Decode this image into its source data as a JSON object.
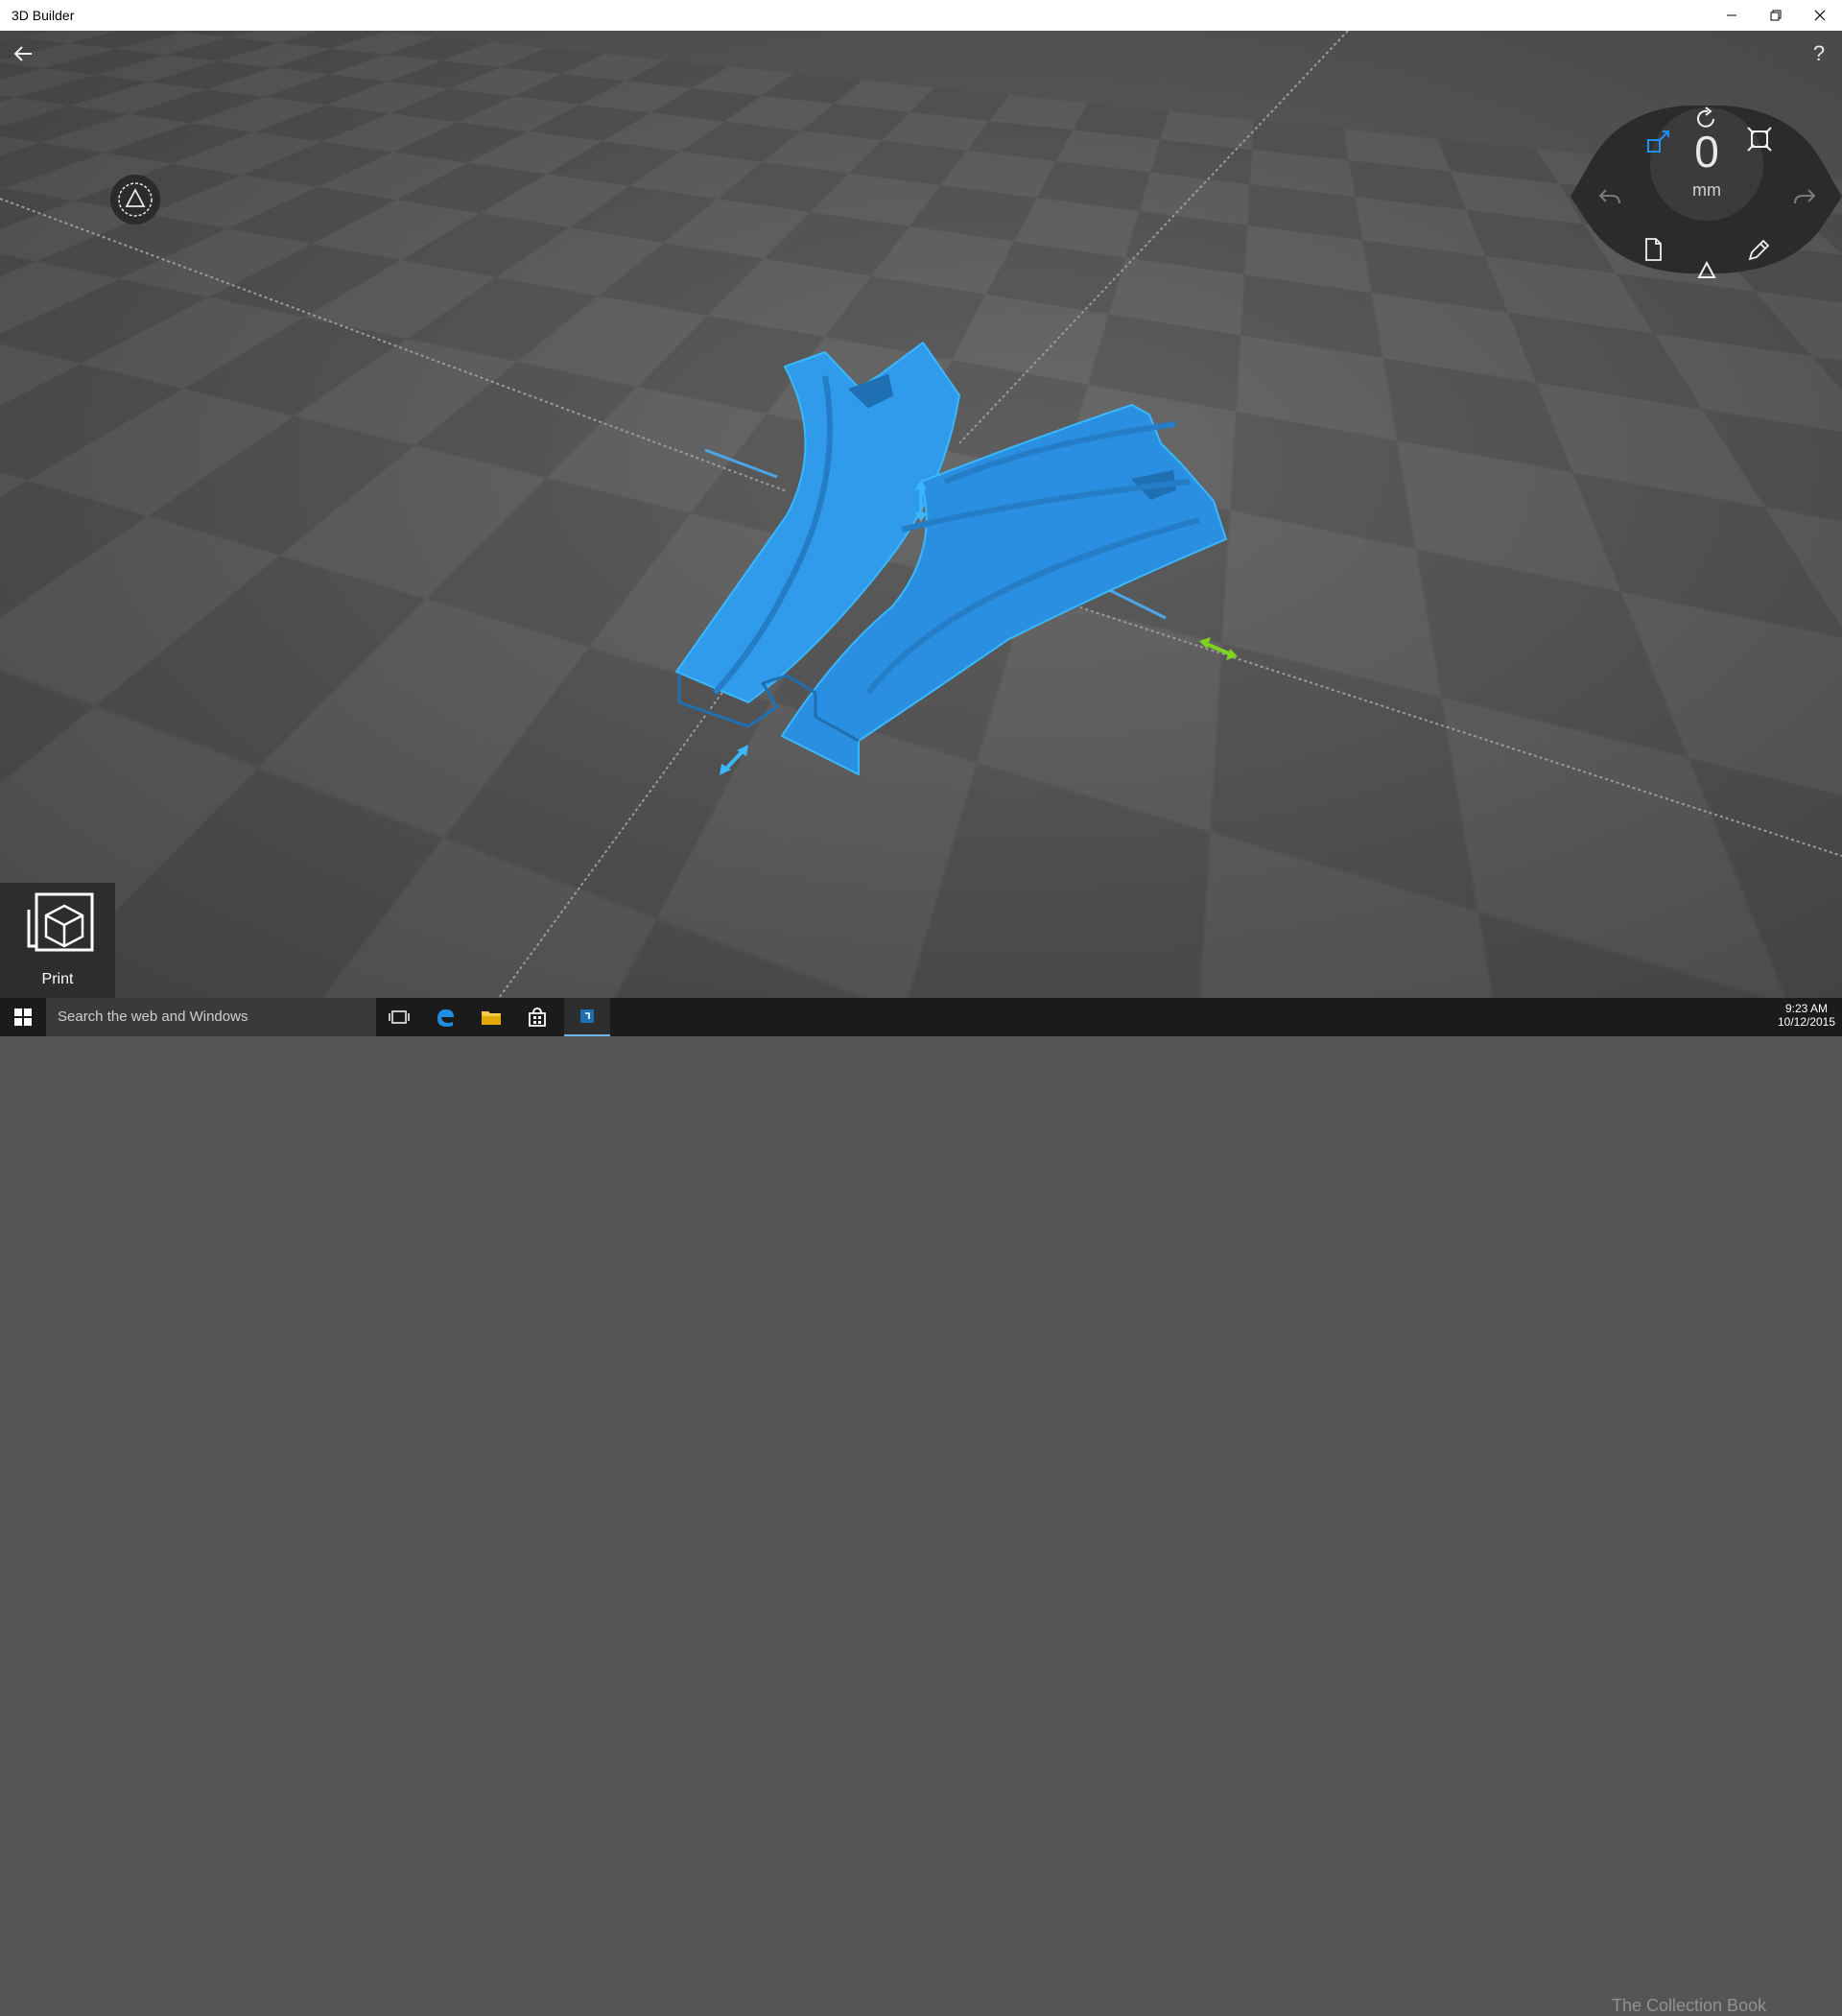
{
  "app": {
    "title": "3D Builder"
  },
  "window_controls": {
    "minimize_icon": "minimize-icon",
    "restore_icon": "restore-icon",
    "close_icon": "close-icon"
  },
  "toolbar": {
    "back_icon": "back-arrow-icon",
    "help_label": "?"
  },
  "snap_button": {
    "icon": "triangle-in-circle-icon"
  },
  "wheel": {
    "value": "0",
    "unit": "mm",
    "icons": [
      "move-icon",
      "rotate-icon",
      "scale-icon",
      "undo-icon",
      "redo-icon",
      "document-icon",
      "triangle-icon",
      "pencil-icon"
    ],
    "accent": "#1e90ff"
  },
  "model": {
    "color": "#2f9bea",
    "outline": "#39b8ff",
    "handle_green": "#7ed321"
  },
  "print": {
    "label": "Print",
    "icon": "print-cube-icon"
  },
  "taskbar": {
    "search_placeholder": "Search the web and Windows",
    "apps": [
      "task-view-icon",
      "edge-icon",
      "file-explorer-icon",
      "store-icon",
      "3d-builder-icon"
    ],
    "time": "9:23 AM",
    "date": "10/12/2015"
  },
  "watermark": "The Collection Book"
}
